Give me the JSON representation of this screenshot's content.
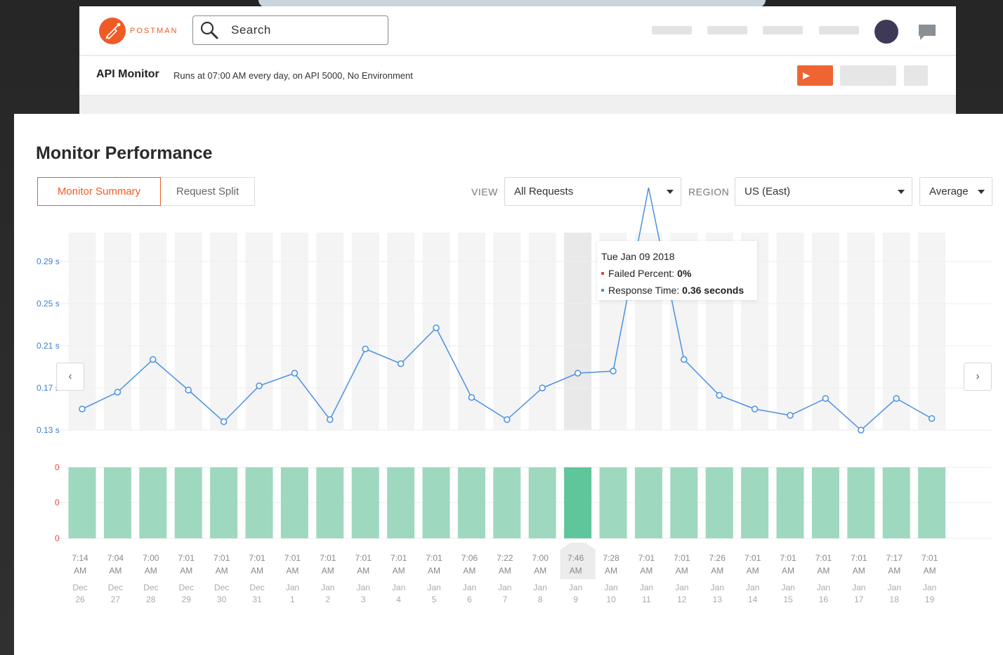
{
  "app": {
    "logo_text": "POSTMAN",
    "search": {
      "value": "Search"
    },
    "accent_color": "#ef5b25",
    "avatar_color": "#3f3958"
  },
  "monitor_bar": {
    "title": "API Monitor",
    "description": "Runs at 07:00 AM every day,  on API 5000, No Environment"
  },
  "panel": {
    "title": "Monitor Performance",
    "tabs": [
      {
        "label": "Monitor Summary",
        "active": true
      },
      {
        "label": "Request Split",
        "active": false
      }
    ],
    "filters": {
      "view_label": "VIEW",
      "view_value": "All Requests",
      "region_label": "REGION",
      "region_value": "US (East)",
      "aggregate_value": "Average"
    }
  },
  "tooltip": {
    "date": "Tue Jan 09 2018",
    "failed_label": "Failed Percent:",
    "failed_value": "0%",
    "response_label": "Response Time:",
    "response_value": "0.36 seconds"
  },
  "chart_data": {
    "type": "line",
    "y_ticks": [
      "0.29 s",
      "0.25 s",
      "0.21 s",
      "0.17 s",
      "0.13 s"
    ],
    "bar_ticks": [
      "0",
      "0",
      "0"
    ],
    "highlight_index": 14,
    "colors": {
      "line": "#4a90e2",
      "bar": "#9ed8bf",
      "bar_highlight": "#5fc59b",
      "column": "#f4f4f4",
      "column_highlight": "#e9e9e9"
    },
    "points": [
      {
        "time": "7:14",
        "ampm": "AM",
        "month": "Dec",
        "day": "26",
        "response": 0.15
      },
      {
        "time": "7:04",
        "ampm": "AM",
        "month": "Dec",
        "day": "27",
        "response": 0.166
      },
      {
        "time": "7:00",
        "ampm": "AM",
        "month": "Dec",
        "day": "28",
        "response": 0.197
      },
      {
        "time": "7:01",
        "ampm": "AM",
        "month": "Dec",
        "day": "29",
        "response": 0.168
      },
      {
        "time": "7:01",
        "ampm": "AM",
        "month": "Dec",
        "day": "30",
        "response": 0.138
      },
      {
        "time": "7:01",
        "ampm": "AM",
        "month": "Dec",
        "day": "31",
        "response": 0.172
      },
      {
        "time": "7:01",
        "ampm": "AM",
        "month": "Jan",
        "day": "1",
        "response": 0.184
      },
      {
        "time": "7:01",
        "ampm": "AM",
        "month": "Jan",
        "day": "2",
        "response": 0.14
      },
      {
        "time": "7:01",
        "ampm": "AM",
        "month": "Jan",
        "day": "3",
        "response": 0.207
      },
      {
        "time": "7:01",
        "ampm": "AM",
        "month": "Jan",
        "day": "4",
        "response": 0.193
      },
      {
        "time": "7:01",
        "ampm": "AM",
        "month": "Jan",
        "day": "5",
        "response": 0.227
      },
      {
        "time": "7:06",
        "ampm": "AM",
        "month": "Jan",
        "day": "6",
        "response": 0.161
      },
      {
        "time": "7:22",
        "ampm": "AM",
        "month": "Jan",
        "day": "7",
        "response": 0.14
      },
      {
        "time": "7:00",
        "ampm": "AM",
        "month": "Jan",
        "day": "8",
        "response": 0.17
      },
      {
        "time": "7:46",
        "ampm": "AM",
        "month": "Jan",
        "day": "9",
        "response": 0.184
      },
      {
        "time": "7:28",
        "ampm": "AM",
        "month": "Jan",
        "day": "10",
        "response": 0.186
      },
      {
        "time": "7:01",
        "ampm": "AM",
        "month": "Jan",
        "day": "11",
        "response": 0.36
      },
      {
        "time": "7:01",
        "ampm": "AM",
        "month": "Jan",
        "day": "12",
        "response": 0.197
      },
      {
        "time": "7:26",
        "ampm": "AM",
        "month": "Jan",
        "day": "13",
        "response": 0.163
      },
      {
        "time": "7:01",
        "ampm": "AM",
        "month": "Jan",
        "day": "14",
        "response": 0.15
      },
      {
        "time": "7:01",
        "ampm": "AM",
        "month": "Jan",
        "day": "15",
        "response": 0.144
      },
      {
        "time": "7:01",
        "ampm": "AM",
        "month": "Jan",
        "day": "16",
        "response": 0.16
      },
      {
        "time": "7:01",
        "ampm": "AM",
        "month": "Jan",
        "day": "17",
        "response": 0.13
      },
      {
        "time": "7:17",
        "ampm": "AM",
        "month": "Jan",
        "day": "18",
        "response": 0.16
      },
      {
        "time": "7:01",
        "ampm": "AM",
        "month": "Jan",
        "day": "19",
        "response": 0.141
      }
    ]
  }
}
